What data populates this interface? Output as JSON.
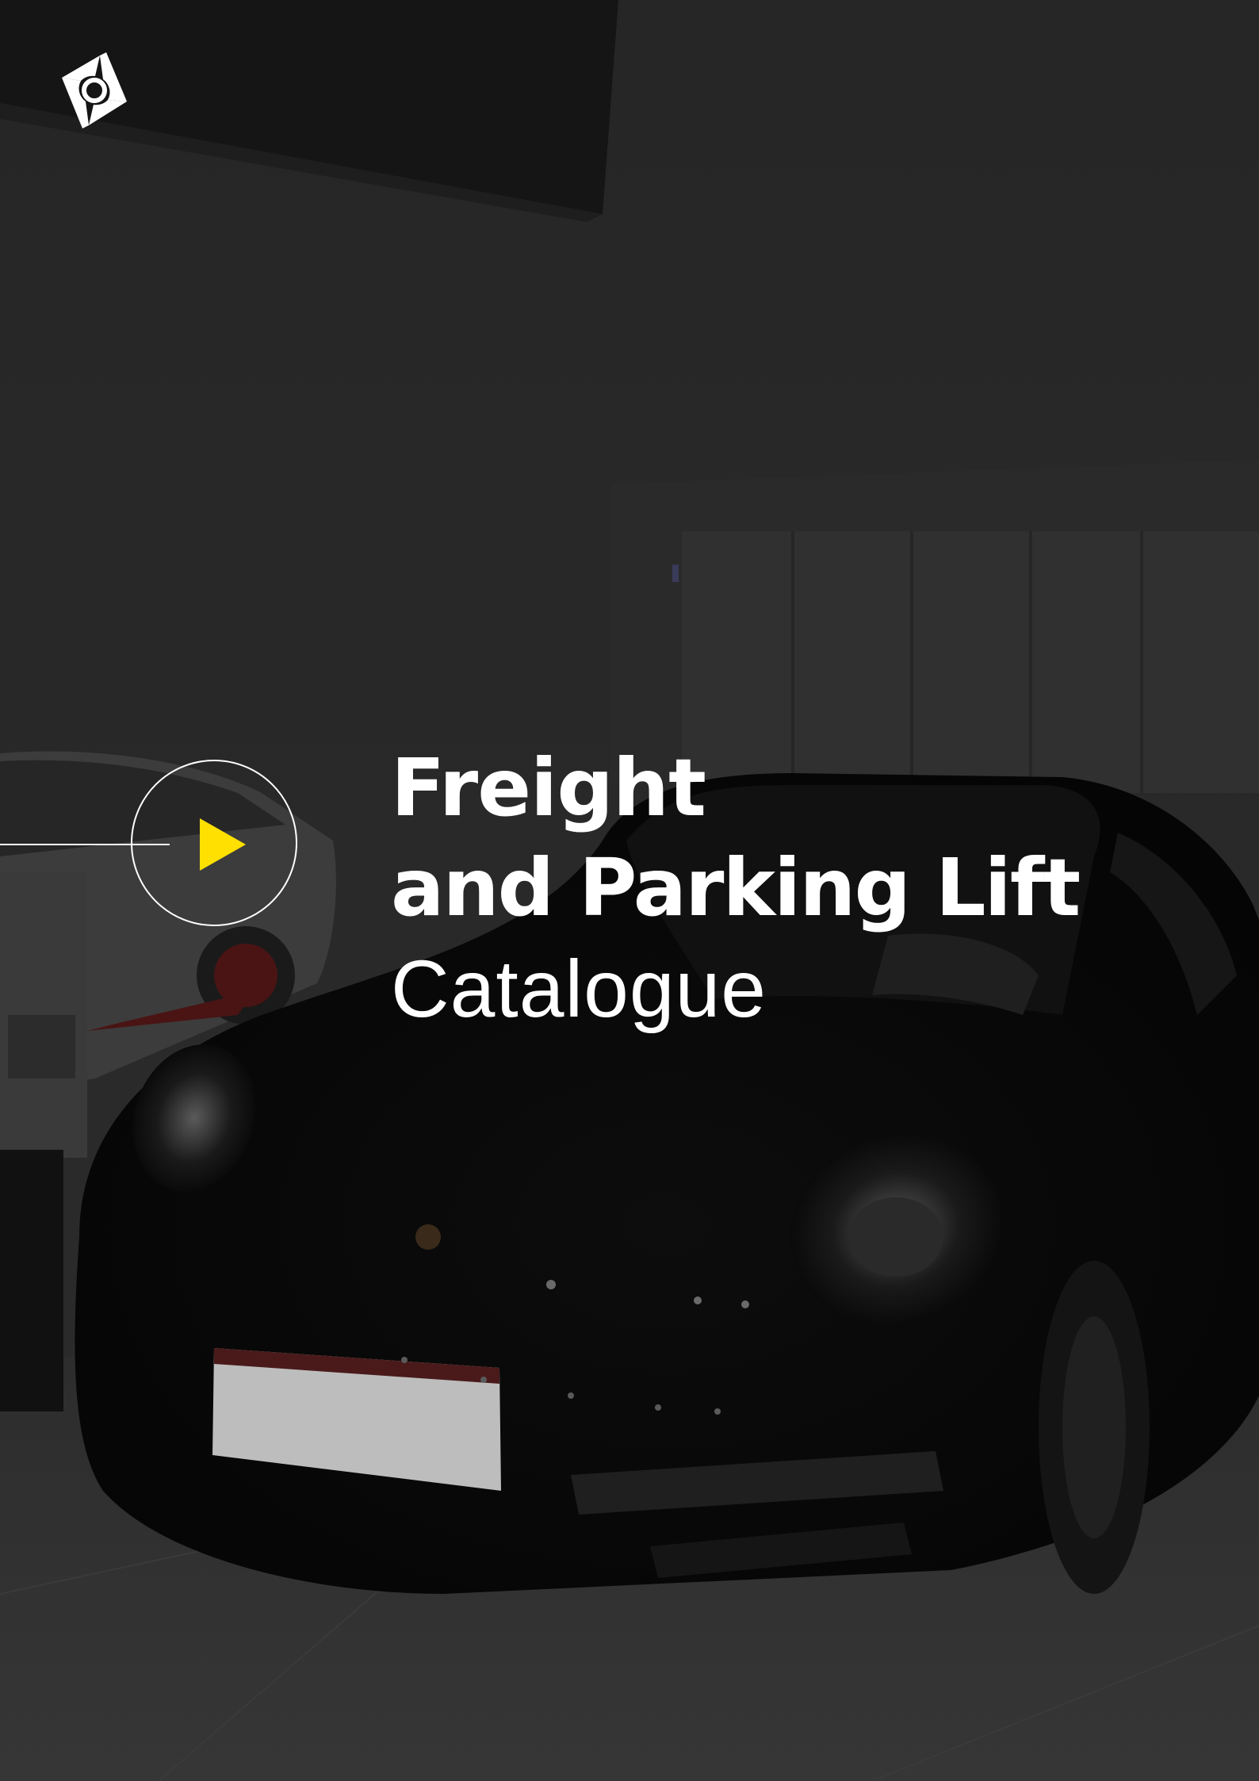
{
  "brand": {
    "logo_icon": "brand-logo-icon"
  },
  "hero": {
    "title_line_1": "Freight",
    "title_line_2": "and Parking Lift",
    "title_line_3": "Catalogue"
  },
  "play_button": {
    "icon": "play-icon",
    "accent_color": "#ffe000"
  }
}
